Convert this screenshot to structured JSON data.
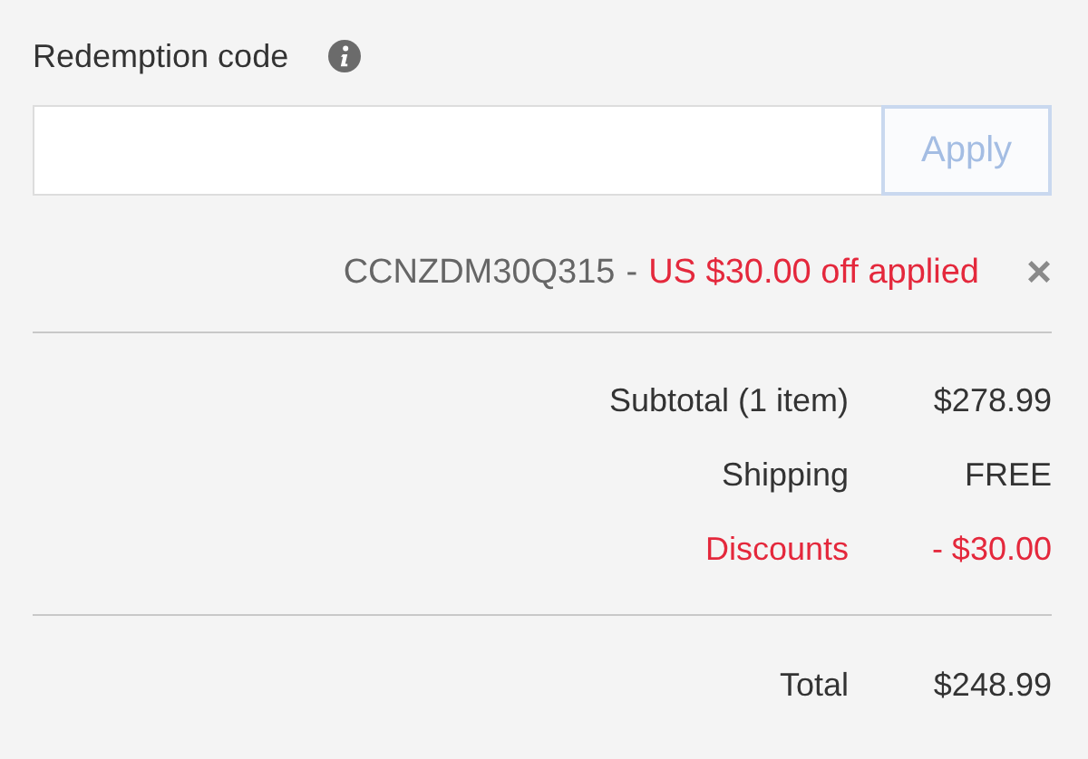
{
  "redemption": {
    "label": "Redemption code",
    "button": "Apply"
  },
  "applied_code": {
    "code": "CCNZDM30Q315",
    "separator": "-",
    "message": "US $30.00 off applied",
    "remove": "×"
  },
  "summary": [
    {
      "kind": "normal",
      "label": "Subtotal (1 item)",
      "value": "$278.99"
    },
    {
      "kind": "normal",
      "label": "Shipping",
      "value": "FREE"
    },
    {
      "kind": "discount",
      "label": "Discounts",
      "value": "- $30.00"
    }
  ],
  "total": {
    "label": "Total",
    "value": "$248.99"
  }
}
